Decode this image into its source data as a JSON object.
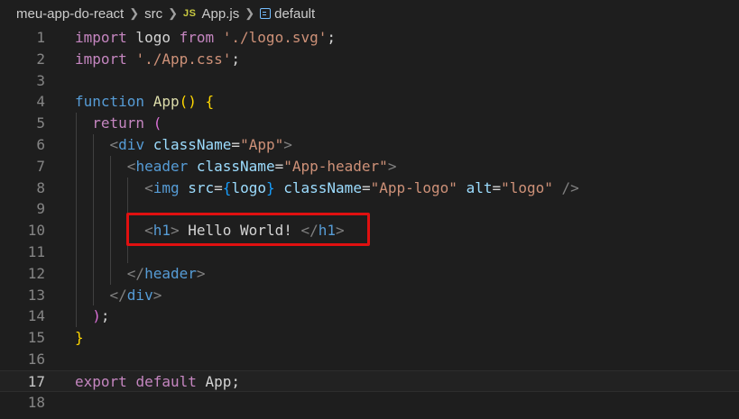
{
  "breadcrumb": {
    "project": "meu-app-do-react",
    "folder": "src",
    "file_badge": "JS",
    "file": "App.js",
    "symbol": "default"
  },
  "colors": {
    "background": "#1e1e1e",
    "keyword": "#569cd6",
    "control_keyword": "#c586c0",
    "function": "#dcdcaa",
    "string": "#ce9178",
    "attribute": "#9cdcfe",
    "highlight": "#e01010"
  },
  "active_line": 17,
  "lines": [
    {
      "n": "1",
      "code": [
        {
          "c": "kw2",
          "t": "import"
        },
        {
          "c": "plain",
          "t": " logo "
        },
        {
          "c": "kw2",
          "t": "from"
        },
        {
          "c": "plain",
          "t": " "
        },
        {
          "c": "str",
          "t": "'./logo.svg'"
        },
        {
          "c": "plain",
          "t": ";"
        }
      ]
    },
    {
      "n": "2",
      "code": [
        {
          "c": "kw2",
          "t": "import"
        },
        {
          "c": "plain",
          "t": " "
        },
        {
          "c": "str",
          "t": "'./App.css'"
        },
        {
          "c": "plain",
          "t": ";"
        }
      ]
    },
    {
      "n": "3",
      "code": []
    },
    {
      "n": "4",
      "code": [
        {
          "c": "kw",
          "t": "function"
        },
        {
          "c": "plain",
          "t": " "
        },
        {
          "c": "fn",
          "t": "App"
        },
        {
          "c": "br",
          "t": "()"
        },
        {
          "c": "plain",
          "t": " "
        },
        {
          "c": "br",
          "t": "{"
        }
      ]
    },
    {
      "n": "5",
      "code": [
        {
          "c": "plain",
          "t": "  "
        },
        {
          "c": "kw2",
          "t": "return"
        },
        {
          "c": "plain",
          "t": " "
        },
        {
          "c": "br2",
          "t": "("
        }
      ]
    },
    {
      "n": "6",
      "code": [
        {
          "c": "plain",
          "t": "    "
        },
        {
          "c": "punc",
          "t": "<"
        },
        {
          "c": "tag",
          "t": "div"
        },
        {
          "c": "plain",
          "t": " "
        },
        {
          "c": "attr",
          "t": "className"
        },
        {
          "c": "plain",
          "t": "="
        },
        {
          "c": "str",
          "t": "\"App\""
        },
        {
          "c": "punc",
          "t": ">"
        }
      ]
    },
    {
      "n": "7",
      "code": [
        {
          "c": "plain",
          "t": "      "
        },
        {
          "c": "punc",
          "t": "<"
        },
        {
          "c": "tag",
          "t": "header"
        },
        {
          "c": "plain",
          "t": " "
        },
        {
          "c": "attr",
          "t": "className"
        },
        {
          "c": "plain",
          "t": "="
        },
        {
          "c": "str",
          "t": "\"App-header\""
        },
        {
          "c": "punc",
          "t": ">"
        }
      ]
    },
    {
      "n": "8",
      "code": [
        {
          "c": "plain",
          "t": "        "
        },
        {
          "c": "punc",
          "t": "<"
        },
        {
          "c": "tag",
          "t": "img"
        },
        {
          "c": "plain",
          "t": " "
        },
        {
          "c": "attr",
          "t": "src"
        },
        {
          "c": "plain",
          "t": "="
        },
        {
          "c": "br3",
          "t": "{"
        },
        {
          "c": "attr",
          "t": "logo"
        },
        {
          "c": "br3",
          "t": "}"
        },
        {
          "c": "plain",
          "t": " "
        },
        {
          "c": "attr",
          "t": "className"
        },
        {
          "c": "plain",
          "t": "="
        },
        {
          "c": "str",
          "t": "\"App-logo\""
        },
        {
          "c": "plain",
          "t": " "
        },
        {
          "c": "attr",
          "t": "alt"
        },
        {
          "c": "plain",
          "t": "="
        },
        {
          "c": "str",
          "t": "\"logo\""
        },
        {
          "c": "plain",
          "t": " "
        },
        {
          "c": "punc",
          "t": "/>"
        }
      ]
    },
    {
      "n": "9",
      "code": []
    },
    {
      "n": "10",
      "code": [
        {
          "c": "plain",
          "t": "        "
        },
        {
          "c": "punc",
          "t": "<"
        },
        {
          "c": "tag",
          "t": "h1"
        },
        {
          "c": "punc",
          "t": ">"
        },
        {
          "c": "txt",
          "t": " Hello World! "
        },
        {
          "c": "punc",
          "t": "</"
        },
        {
          "c": "tag",
          "t": "h1"
        },
        {
          "c": "punc",
          "t": ">"
        }
      ]
    },
    {
      "n": "11",
      "code": []
    },
    {
      "n": "12",
      "code": [
        {
          "c": "plain",
          "t": "      "
        },
        {
          "c": "punc",
          "t": "</"
        },
        {
          "c": "tag",
          "t": "header"
        },
        {
          "c": "punc",
          "t": ">"
        }
      ]
    },
    {
      "n": "13",
      "code": [
        {
          "c": "plain",
          "t": "    "
        },
        {
          "c": "punc",
          "t": "</"
        },
        {
          "c": "tag",
          "t": "div"
        },
        {
          "c": "punc",
          "t": ">"
        }
      ]
    },
    {
      "n": "14",
      "code": [
        {
          "c": "plain",
          "t": "  "
        },
        {
          "c": "br2",
          "t": ")"
        },
        {
          "c": "plain",
          "t": ";"
        }
      ]
    },
    {
      "n": "15",
      "code": [
        {
          "c": "br",
          "t": "}"
        }
      ]
    },
    {
      "n": "16",
      "code": []
    },
    {
      "n": "17",
      "code": [
        {
          "c": "kw2",
          "t": "export"
        },
        {
          "c": "plain",
          "t": " "
        },
        {
          "c": "kw2",
          "t": "default"
        },
        {
          "c": "plain",
          "t": " App;"
        }
      ]
    },
    {
      "n": "18",
      "code": []
    }
  ]
}
